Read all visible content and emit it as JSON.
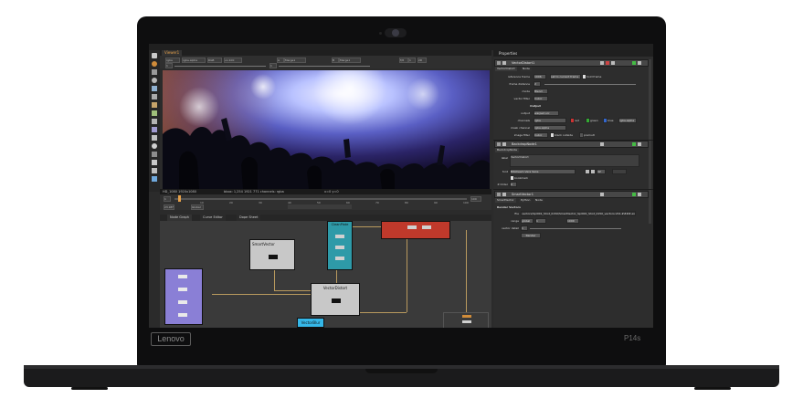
{
  "device": {
    "bezel_brand": "Lenovo",
    "model": "P14s"
  },
  "app": {
    "menu": [
      "File",
      "Edit",
      "Workspace",
      "Viewer",
      "Render",
      "Cache",
      "Help"
    ],
    "viewer_tab": "Viewer1",
    "toolbar": {
      "channel_set": "rgba",
      "channel": "rgba.alpha",
      "colorspace": "RGB",
      "zoom": "vo:100",
      "input_a": "A",
      "merge_a": "Merge1",
      "input_b": "B",
      "merge_b": "Merge1",
      "fstop": "f/8",
      "frame": "1",
      "proxy": "2D",
      "gain": "1",
      "gamma": "1"
    },
    "viewer_info": {
      "format": "HD_1080 1920x1080",
      "status": "bbox: 1,254 1921 771 channels: rgba",
      "coords": "x=0 y=0"
    },
    "timeline": {
      "start": "1",
      "end": "100",
      "fps": "23.98*",
      "mode": "Global",
      "ticks": [
        "10",
        "20",
        "30",
        "40",
        "50",
        "60",
        "70",
        "80",
        "90",
        "100"
      ]
    },
    "graph_tabs": [
      "Node Graph",
      "Curve Editor",
      "Dope Sheet"
    ],
    "nodes": {
      "smartvector": "SmartVector",
      "cleanplate": "CleanPlate",
      "vectordistort": "VectorDistort",
      "vectorblur": "VectorBlur"
    },
    "properties": {
      "tab": "Properties",
      "vd_header": "VectorDistort1",
      "vd_tabs": [
        "VectorDistort",
        "Node"
      ],
      "reference_frame_label": "reference frame",
      "reference_frame": "1006",
      "set_current": "set to current frame",
      "hold_frame": "hold frame",
      "frame_distance_label": "frame distance",
      "frame_distance": "2",
      "mode_label": "mode",
      "mode": "Blend",
      "vector_filter_label": "vector filter",
      "vector_filter": "Cubic",
      "output_heading": "Output",
      "output_label": "output",
      "output": "warped src",
      "channels_label": "channels",
      "channels": "rgba",
      "channel_flags": [
        "red",
        "green",
        "blue",
        "rgba.alpha"
      ],
      "mask_label": "mask channel",
      "mask": "rgba.alpha",
      "image_filter_label": "image filter",
      "image_filter": "Cubic",
      "black_outside": "black outside",
      "premult": "premult",
      "bd_header": "BackdropNode1",
      "bd_tab": "BackdropNode",
      "label_label": "label",
      "label_value": "VectorDistort",
      "font_label": "font",
      "font": "Bitstream Vera Sans",
      "font_size": "42",
      "bookmark": "bookmark",
      "zorder_label": "Z Order",
      "zorder": "0",
      "sv_header": "SmartVector1",
      "sv_tabs": [
        "SmartVector",
        "Python",
        "Node"
      ],
      "render_vectors": "Render Vectors",
      "file_label": "file",
      "file": "vectors/Split01_Shot_0150/SmartVector_Split01_Shot_0150_vectors.V01.####.exr",
      "range_label": "range",
      "range_mode": "global",
      "range_start": "1",
      "range_end": "1000",
      "vector_detail_label": "vector detail",
      "vector_detail": "1",
      "render_btn": "Render"
    }
  },
  "colors": {
    "accent": "#e6a14a",
    "node_smartvector": "#bdbdbd",
    "node_cleanplate": "#2e9aa8",
    "node_red": "#c0392b",
    "node_purple": "#8a7fd6",
    "node_vectorblur": "#35b7e8",
    "wire": "#b99a5e"
  }
}
